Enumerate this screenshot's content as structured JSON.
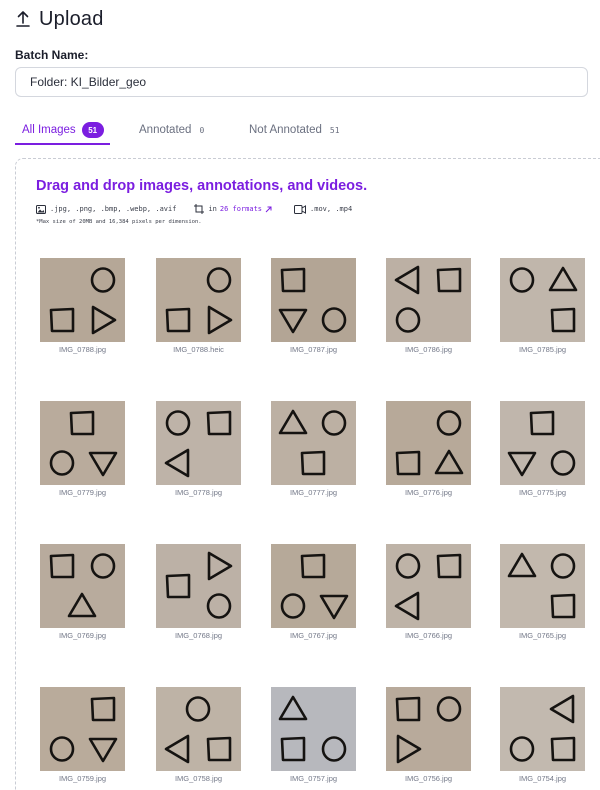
{
  "header": {
    "title": "Upload",
    "icon": "upload-icon"
  },
  "batch": {
    "label": "Batch Name:",
    "value": "Folder: KI_Bilder_geo"
  },
  "tabs": [
    {
      "label": "All Images",
      "count": "51",
      "active": true
    },
    {
      "label": "Annotated",
      "count": "0",
      "active": false
    },
    {
      "label": "Not Annotated",
      "count": "51",
      "active": false
    }
  ],
  "dropzone": {
    "title": "Drag and drop images, annotations, and videos.",
    "image_formats": ".jpg, .png, .bmp, .webp, .avif",
    "annotation_prefix": "in",
    "annotation_link": "26 formats",
    "video_formats": ".mov, .mp4",
    "note": "*Max size of 20MB and 16,384 pixels per dimension."
  },
  "colors": {
    "accent": "#7b1ee0"
  },
  "images": [
    {
      "name": "IMG_0788.jpg",
      "bg": "#b5a797",
      "shapes": [
        "circle-tr",
        "square-bl",
        "tri-right-br"
      ]
    },
    {
      "name": "IMG_0788.heic",
      "bg": "#b8aa9a",
      "shapes": [
        "circle-tr",
        "square-bl",
        "tri-right-br"
      ]
    },
    {
      "name": "IMG_0787.jpg",
      "bg": "#b3a595",
      "shapes": [
        "square-tl",
        "tri-down-bl",
        "circle-br"
      ]
    },
    {
      "name": "IMG_0786.jpg",
      "bg": "#bcb0a4",
      "shapes": [
        "tri-left-tl",
        "square-tr",
        "circle-bl"
      ]
    },
    {
      "name": "IMG_0785.jpg",
      "bg": "#c0b6ab",
      "shapes": [
        "circle-tl",
        "tri-up-tr",
        "square-br"
      ]
    },
    {
      "name": "IMG_0779.jpg",
      "bg": "#b9ab9c",
      "shapes": [
        "square-tc",
        "circle-bl",
        "tri-down-br"
      ]
    },
    {
      "name": "IMG_0778.jpg",
      "bg": "#beb3a8",
      "shapes": [
        "circle-tl",
        "square-tr",
        "tri-left-bl"
      ]
    },
    {
      "name": "IMG_0777.jpg",
      "bg": "#bcb0a3",
      "shapes": [
        "tri-up-tl",
        "circle-tr",
        "square-bc"
      ]
    },
    {
      "name": "IMG_0776.jpg",
      "bg": "#b7a999",
      "shapes": [
        "circle-tr",
        "square-bl",
        "tri-up-br"
      ]
    },
    {
      "name": "IMG_0775.jpg",
      "bg": "#c0b6ac",
      "shapes": [
        "square-tc",
        "tri-down-bl",
        "circle-br"
      ]
    },
    {
      "name": "IMG_0769.jpg",
      "bg": "#b8ab9d",
      "shapes": [
        "square-tl",
        "circle-tr",
        "tri-up-bc"
      ]
    },
    {
      "name": "IMG_0768.jpg",
      "bg": "#bcb1a6",
      "shapes": [
        "tri-right-tr",
        "square-ml",
        "circle-br"
      ]
    },
    {
      "name": "IMG_0767.jpg",
      "bg": "#b6a999",
      "shapes": [
        "square-tc",
        "circle-bl",
        "tri-down-br"
      ]
    },
    {
      "name": "IMG_0766.jpg",
      "bg": "#beb3a7",
      "shapes": [
        "circle-tl",
        "square-tr",
        "tri-left-bl"
      ]
    },
    {
      "name": "IMG_0765.jpg",
      "bg": "#c2b8ad",
      "shapes": [
        "tri-up-tl",
        "circle-tr",
        "square-br"
      ]
    },
    {
      "name": "IMG_0759.jpg",
      "bg": "#b9ab9b",
      "shapes": [
        "circle-bl",
        "square-tr",
        "tri-down-br"
      ]
    },
    {
      "name": "IMG_0758.jpg",
      "bg": "#beb3a6",
      "shapes": [
        "circle-tc",
        "tri-left-bl",
        "square-br"
      ]
    },
    {
      "name": "IMG_0757.jpg",
      "bg": "#b7b8bd",
      "shapes": [
        "tri-up-tl",
        "square-bl",
        "circle-br"
      ]
    },
    {
      "name": "IMG_0756.jpg",
      "bg": "#b8aa9b",
      "shapes": [
        "square-tl",
        "circle-tr",
        "tri-right-bl"
      ]
    },
    {
      "name": "IMG_0754.jpg",
      "bg": "#c2b9af",
      "shapes": [
        "tri-left-tr",
        "circle-bl",
        "square-br"
      ]
    }
  ]
}
